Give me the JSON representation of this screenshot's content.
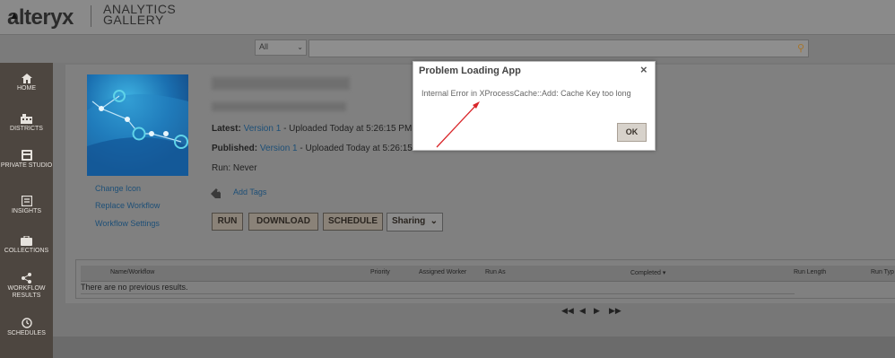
{
  "header": {
    "logo": "alteryx",
    "gallery_line1": "ANALYTICS",
    "gallery_line2": "GALLERY"
  },
  "search": {
    "scope": "All",
    "query": ""
  },
  "sidebar": {
    "items": [
      {
        "label": "HOME",
        "icon": "home-icon"
      },
      {
        "label": "DISTRICTS",
        "icon": "districts-icon"
      },
      {
        "label": "PRIVATE STUDIO",
        "icon": "studio-icon"
      },
      {
        "label": "INSIGHTS",
        "icon": "insights-icon"
      },
      {
        "label": "COLLECTIONS",
        "icon": "collections-icon"
      },
      {
        "label": "WORKFLOW RESULTS",
        "icon": "workflow-results-icon"
      },
      {
        "label": "SCHEDULES",
        "icon": "schedules-icon"
      }
    ]
  },
  "workflow": {
    "side_links": [
      "Change Icon",
      "Replace Workflow",
      "Workflow Settings"
    ],
    "latest_label": "Latest:",
    "latest_version": "Version 1",
    "latest_rest": "- Uploaded Today at 5:26:15 PM",
    "published_label": "Published:",
    "published_version": "Version 1",
    "published_rest": "- Uploaded Today at 5:26:15",
    "run": "Run: Never",
    "add_tags": "Add Tags"
  },
  "actions": {
    "run": "RUN",
    "download": "DOWNLOAD",
    "schedule": "SCHEDULE",
    "sharing": "Sharing"
  },
  "table": {
    "columns": [
      "Name/Workflow",
      "Priority",
      "Assigned Worker",
      "Run As",
      "Completed",
      "Run Length",
      "Run Typ"
    ],
    "empty_message": "There are no previous results."
  },
  "dialog": {
    "title": "Problem Loading App",
    "message": "Internal Error in XProcessCache::Add: Cache Key too long",
    "ok": "OK",
    "close": "×"
  },
  "colors": {
    "link": "#1d4f77",
    "sidebar": "#4d4640",
    "annotation_arrow": "#d9262a"
  }
}
